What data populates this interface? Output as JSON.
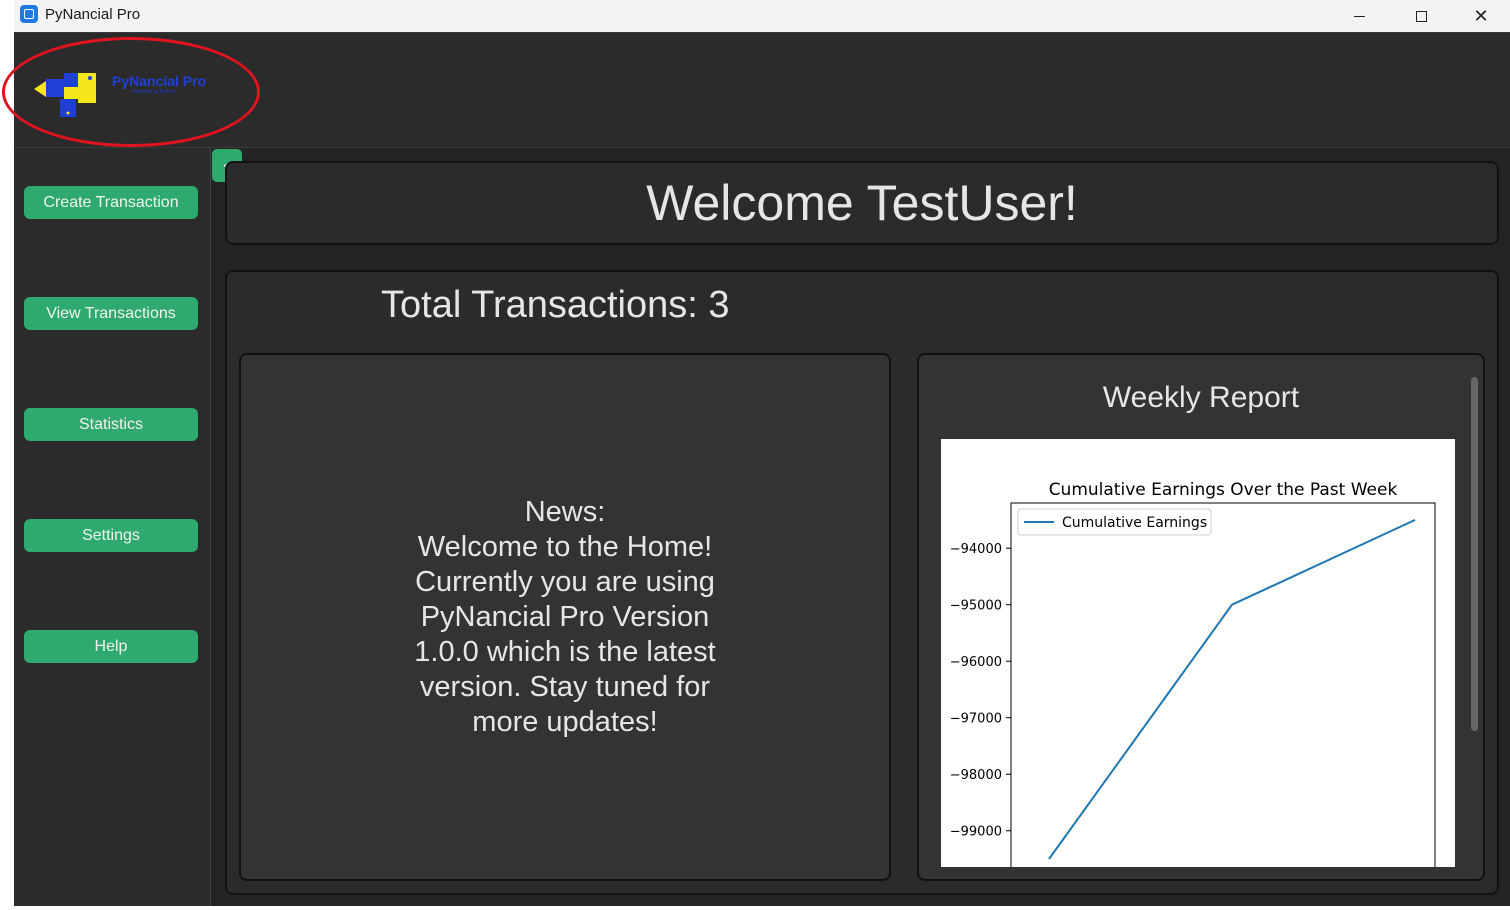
{
  "window": {
    "title": "PyNancial Pro"
  },
  "logo": {
    "text": "PyNancial Pro",
    "subtext": "Powered by Python"
  },
  "sidebar": {
    "collapse_label": "<",
    "items": [
      {
        "label": "Create Transaction"
      },
      {
        "label": "View Transactions"
      },
      {
        "label": "Statistics"
      },
      {
        "label": "Settings"
      },
      {
        "label": "Help"
      }
    ]
  },
  "main": {
    "welcome": "Welcome TestUser!",
    "total_transactions": "Total Transactions: 3",
    "news": "News:\nWelcome to the Home!\nCurrently you are using\nPyNancial Pro Version\n1.0.0 which is the latest\nversion. Stay tuned for\nmore updates!",
    "report_title": "Weekly Report"
  },
  "chart_data": {
    "type": "line",
    "title": "Cumulative Earnings Over the Past Week",
    "xlabel": "",
    "ylabel": "",
    "legend_position": "top-left",
    "grid": false,
    "ylim": [
      -99500,
      -93200
    ],
    "yticks": [
      -94000,
      -95000,
      -96000,
      -97000,
      -98000,
      -99000
    ],
    "series": [
      {
        "name": "Cumulative Earnings",
        "x": [
          0,
          1,
          2
        ],
        "y": [
          -99500,
          -95000,
          -93500
        ]
      }
    ]
  },
  "colors": {
    "accent": "#2eaa6e",
    "line": "#1f77b4",
    "annotation": "#e0141e"
  }
}
